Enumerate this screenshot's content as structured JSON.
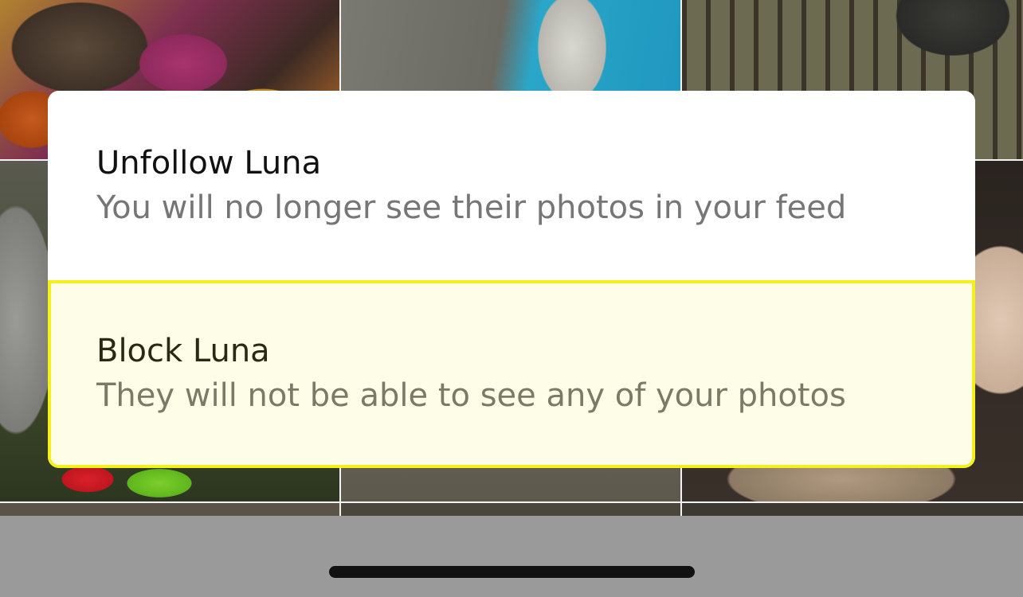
{
  "action_sheet": {
    "options": [
      {
        "title": "Unfollow Luna",
        "subtitle": "You will no longer see their photos in your feed"
      },
      {
        "title": "Block Luna",
        "subtitle": "They will not be able to see any of your photos",
        "highlighted": true
      }
    ]
  },
  "colors": {
    "highlight_border": "#f6f01a",
    "highlight_fill": "#fefee8",
    "home_indicator": "#111111"
  }
}
